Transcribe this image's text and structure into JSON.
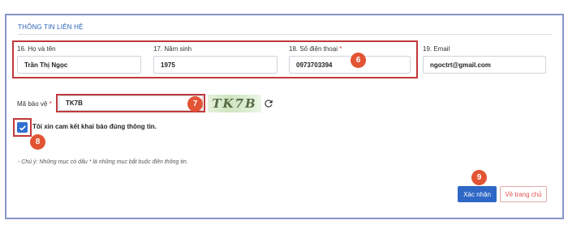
{
  "section": {
    "title": "THÔNG TIN LIÊN HỆ"
  },
  "fields": {
    "full_name": {
      "label": "16. Họ và tên",
      "value": "Trần Thị Ngọc"
    },
    "birth_year": {
      "label": "17. Năm sinh",
      "value": "1975"
    },
    "phone": {
      "label": "18. Số điện thoại",
      "required_mark": "*",
      "value": "0973703394"
    },
    "email": {
      "label": "19. Email",
      "value": "ngoctrt@gmail.com"
    }
  },
  "captcha": {
    "label": "Mã bảo vệ",
    "required_mark": "*",
    "value": "TK7B",
    "image_text": "TK7B",
    "refresh_icon": "refresh-icon"
  },
  "commitment": {
    "checked": true,
    "label": "Tôi xin cam kết khai báo đúng thông tin."
  },
  "note": "- Chú ý: Những mục có dấu * là những mục bắt buộc điền thông tin.",
  "buttons": {
    "confirm": "Xác nhận",
    "home": "Về trang chủ"
  },
  "badges": {
    "phone": "6",
    "captcha": "7",
    "commitment": "8",
    "confirm": "9"
  },
  "colors": {
    "accent": "#2f67c6",
    "highlight": "#c0393b",
    "badge": "#e25434",
    "section_title": "#2a62b8"
  }
}
